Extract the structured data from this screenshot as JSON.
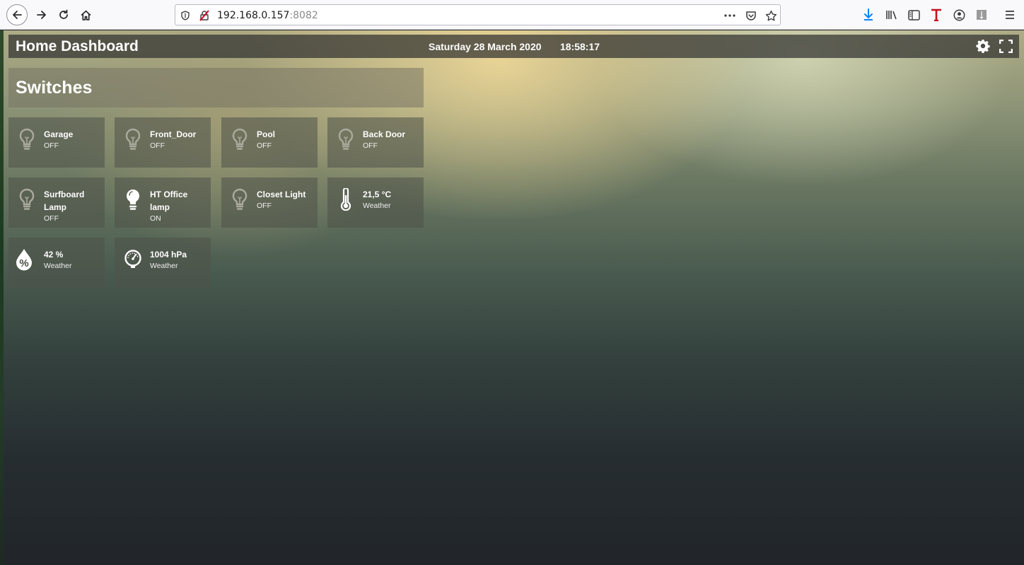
{
  "browser": {
    "url_host": "192.168.0.157",
    "url_port": ":8082"
  },
  "header": {
    "title": "Home Dashboard",
    "date": "Saturday 28 March 2020",
    "time": "18:58:17"
  },
  "section": {
    "title": "Switches"
  },
  "tiles": [
    {
      "name": "Garage",
      "state": "OFF",
      "icon": "lightbulb-off-icon"
    },
    {
      "name": "Front_Door",
      "state": "OFF",
      "icon": "lightbulb-off-icon"
    },
    {
      "name": "Pool",
      "state": "OFF",
      "icon": "lightbulb-off-icon"
    },
    {
      "name": "Back Door",
      "state": "OFF",
      "icon": "lightbulb-off-icon"
    },
    {
      "name": "Surfboard Lamp",
      "state": "OFF",
      "icon": "lightbulb-off-icon"
    },
    {
      "name": "HT Office lamp",
      "state": "ON",
      "icon": "lightbulb-on-icon"
    },
    {
      "name": "Closet Light",
      "state": "OFF",
      "icon": "lightbulb-off-icon"
    },
    {
      "name": "21,5 °C",
      "state": "Weather",
      "icon": "thermometer-icon"
    },
    {
      "name": "42 %",
      "state": "Weather",
      "icon": "humidity-icon"
    },
    {
      "name": "1004 hPa",
      "state": "Weather",
      "icon": "barometer-icon"
    }
  ],
  "colors": {
    "tile_bg": "#4e5248",
    "text": "#ffffff",
    "icon_off": "#a9aa9c",
    "icon_on": "#ffffff"
  }
}
